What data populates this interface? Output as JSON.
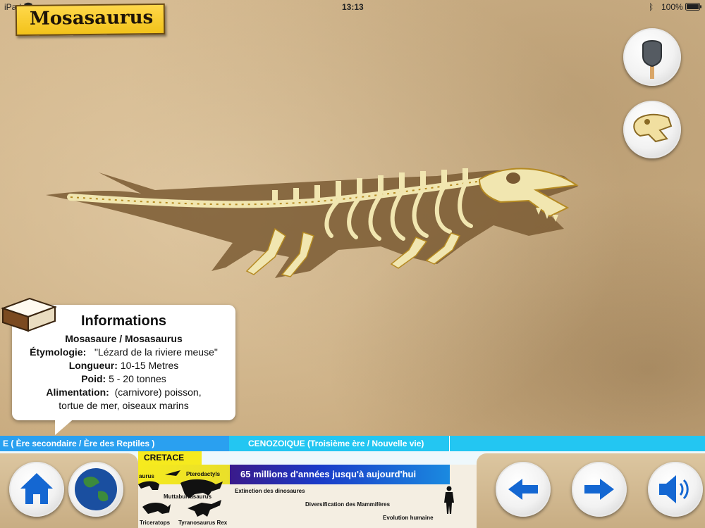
{
  "status_bar": {
    "device": "iPad",
    "time": "13:13",
    "battery": "100%"
  },
  "title": "Mosasaurus",
  "tools": {
    "dig_icon": "shovel-icon",
    "skull_icon": "dino-skull-icon"
  },
  "info": {
    "heading": "Informations",
    "name": "Mosasaure / Mosasaurus",
    "etymology_label": "Étymologie:",
    "etymology_value": "\"Lézard de la riviere meuse\"",
    "length_label": "Longueur:",
    "length_value": "10-15 Metres",
    "weight_label": "Poid:",
    "weight_value": "5 - 20 tonnes",
    "diet_label": "Alimentation:",
    "diet_value": "(carnivore) poisson,",
    "diet_value_2": "tortue de mer, oiseaux marins"
  },
  "timeline": {
    "era_left": "E   ( Ère secondaire / Ère des Reptiles )",
    "era_right": "CENOZOIQUE  (Troisième ère / Nouvelle vie)",
    "period": "CRETACE",
    "span": "65 millions d'années jusqu'à aujourd'hui",
    "labels": [
      "aurus",
      "Pterodactyls",
      "Muttaburrasaurus",
      "Triceratops",
      "Tyranosaurus Rex",
      "Extinction des dinosaures",
      "Diversification des Mammifères",
      "Evolution humaine"
    ]
  },
  "nav": {
    "home": "home-icon",
    "globe": "globe-icon",
    "prev": "arrow-left-icon",
    "next": "arrow-right-icon",
    "sound": "speaker-icon"
  },
  "colors": {
    "banner": "#f2c21a",
    "era_blue": "#2aa0f0",
    "era_cyan": "#23c6f2",
    "period_yellow": "#f6ea1e",
    "button_blue": "#1467d2"
  }
}
